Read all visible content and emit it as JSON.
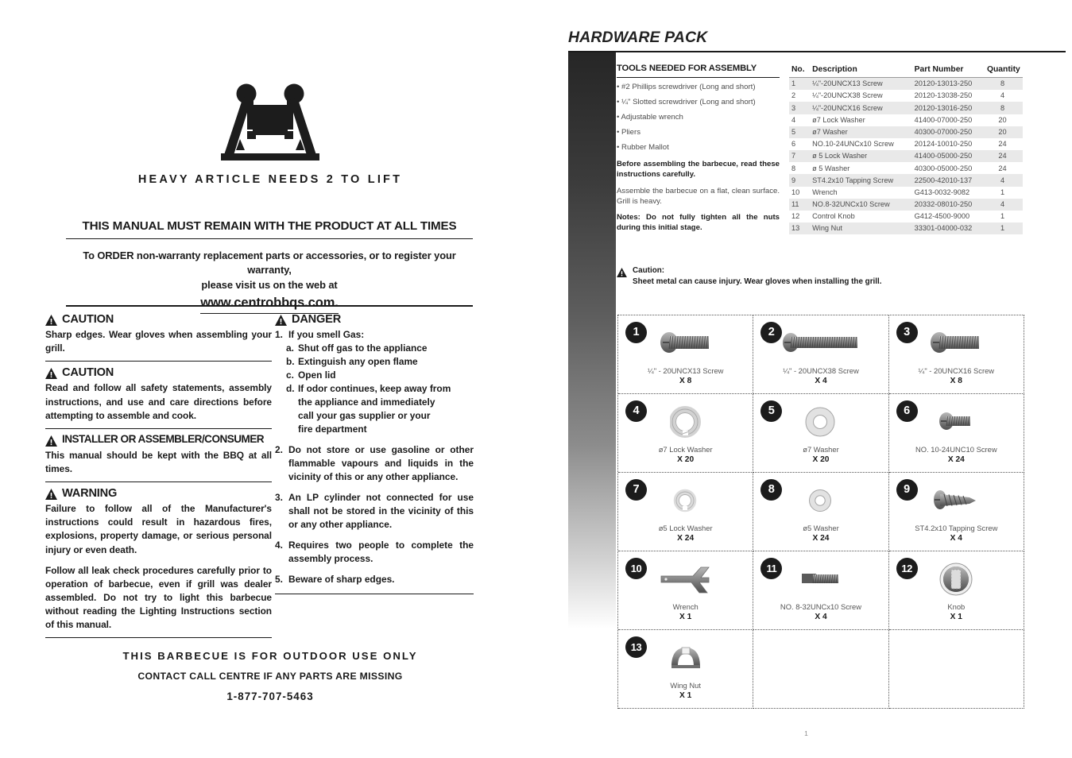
{
  "left": {
    "lift_icon_name": "two-person-lift-icon",
    "lift_caption": "HEAVY ARTICLE NEEDS 2 TO LIFT",
    "manual_banner": "THIS MANUAL MUST REMAIN WITH THE PRODUCT AT ALL TIMES",
    "order_line1": "To ORDER non-warranty replacement parts or accessories, or to register your warranty,",
    "order_line2": "please visit us on the web at",
    "order_url": "www.centrobbqs.com.",
    "sections": [
      {
        "title": "CAUTION",
        "body": "Sharp edges. Wear gloves when assembling your grill."
      },
      {
        "title": "CAUTION",
        "body": "Read and follow all safety statements, assembly instructions, and use and care directions before attempting to assemble and cook."
      },
      {
        "title": "INSTALLER OR ASSEMBLER/CONSUMER",
        "body": "This manual should be kept with the BBQ at all times."
      },
      {
        "title": "WARNING",
        "body": "Failure to follow all of the Manufacturer's instructions could result in hazardous fires, explosions, property damage, or serious personal injury or even death.",
        "body2": "Follow all leak check procedures carefully prior to operation of barbecue, even if grill was dealer assembled. Do not try to light this barbecue without reading the Lighting Instructions section of this manual."
      }
    ],
    "danger": {
      "title": "DANGER",
      "item1_num": "1.",
      "item1_text": "If you smell Gas:",
      "item1_subs": [
        {
          "num": "a.",
          "text": "Shut off gas to the appliance"
        },
        {
          "num": "b.",
          "text": "Extinguish any open flame"
        },
        {
          "num": "c.",
          "text": "Open lid"
        },
        {
          "num": "d.",
          "text": "If odor continues, keep away from"
        }
      ],
      "item1_cont1": "the appliance and immediately",
      "item1_cont2": "call your gas supplier or your",
      "item1_cont3": "fire department",
      "items": [
        {
          "num": "2.",
          "text": "Do not store or use gasoline or other flammable vapours and liquids in the vicinity of this or any other appliance."
        },
        {
          "num": "3.",
          "text": "An LP cylinder not connected for use shall not be stored in the vicinity of this or any other appliance."
        },
        {
          "num": "4.",
          "text": "Requires two people to complete the assembly process."
        },
        {
          "num": "5.",
          "text": "Beware of sharp edges."
        }
      ]
    },
    "bottom_line1": "THIS BARBECUE IS FOR OUTDOOR USE ONLY",
    "bottom_line2": "CONTACT CALL CENTRE IF ANY PARTS ARE MISSING",
    "bottom_phone": "1-877-707-5463"
  },
  "right": {
    "title": "HARDWARE PACK",
    "page_number": "1",
    "tools": {
      "heading": "TOOLS NEEDED FOR ASSEMBLY",
      "items": [
        "• #2 Phillips screwdriver (Long and short)",
        "• ¼\" Slotted screwdriver (Long and short)",
        "• Adjustable wrench",
        "• Pliers",
        "• Rubber Mallot"
      ],
      "before_text": "Before assembling the barbecue, read these instructions carefully.",
      "assemble_text": "Assemble the barbecue on a flat, clean surface. Grill is heavy.",
      "notes_text": "Notes: Do not fully tighten all the nuts during this initial stage."
    },
    "table": {
      "headers": [
        "No.",
        "Description",
        "Part Number",
        "Quantity"
      ],
      "rows": [
        [
          "1",
          "¼\"-20UNCX13 Screw",
          "20120-13013-250",
          "8"
        ],
        [
          "2",
          "¼\"-20UNCX38 Screw",
          "20120-13038-250",
          "4"
        ],
        [
          "3",
          "¼\"-20UNCX16 Screw",
          "20120-13016-250",
          "8"
        ],
        [
          "4",
          "ø7 Lock Washer",
          "41400-07000-250",
          "20"
        ],
        [
          "5",
          "ø7 Washer",
          "40300-07000-250",
          "20"
        ],
        [
          "6",
          "NO.10-24UNCx10 Screw",
          "20124-10010-250",
          "24"
        ],
        [
          "7",
          "ø 5 Lock Washer",
          "41400-05000-250",
          "24"
        ],
        [
          "8",
          "ø 5 Washer",
          "40300-05000-250",
          "24"
        ],
        [
          "9",
          "ST4.2x10 Tapping Screw",
          "22500-42010-137",
          "4"
        ],
        [
          "10",
          "Wrench",
          "G413-0032-9082",
          "1"
        ],
        [
          "11",
          "NO.8-32UNCx10 Screw",
          "20332-08010-250",
          "4"
        ],
        [
          "12",
          "Control Knob",
          "G412-4500-9000",
          "1"
        ],
        [
          "13",
          "Wing Nut",
          "33301-04000-032",
          "1"
        ]
      ]
    },
    "caution": {
      "label": "Caution:",
      "text": "Sheet metal can cause injury. Wear gloves when installing the grill."
    },
    "hardware": [
      {
        "num": "1",
        "art": "pan-head-screw-medium",
        "label": "¼\" - 20UNCX13 Screw",
        "qty": "X 8"
      },
      {
        "num": "2",
        "art": "pan-head-screw-long",
        "label": "¼\" - 20UNCX38 Screw",
        "qty": "X 4"
      },
      {
        "num": "3",
        "art": "pan-head-screw-medium",
        "label": "¼\" - 20UNCX16 Screw",
        "qty": "X 8"
      },
      {
        "num": "4",
        "art": "lock-washer",
        "label": "ø7 Lock Washer",
        "qty": "X 20"
      },
      {
        "num": "5",
        "art": "flat-washer",
        "label": "ø7 Washer",
        "qty": "X 20"
      },
      {
        "num": "6",
        "art": "pan-head-screw-short",
        "label": "NO. 10-24UNC10 Screw",
        "qty": "X 24"
      },
      {
        "num": "7",
        "art": "lock-washer-small",
        "label": "ø5 Lock Washer",
        "qty": "X 24"
      },
      {
        "num": "8",
        "art": "flat-washer-small",
        "label": "ø5 Washer",
        "qty": "X 24"
      },
      {
        "num": "9",
        "art": "tapping-screw",
        "label": "ST4.2x10 Tapping Screw",
        "qty": "X 4"
      },
      {
        "num": "10",
        "art": "wrench",
        "label": "Wrench",
        "qty": "X 1"
      },
      {
        "num": "11",
        "art": "flat-head-screw",
        "label": "NO. 8-32UNCx10 Screw",
        "qty": "X 4"
      },
      {
        "num": "12",
        "art": "control-knob",
        "label": "Knob",
        "qty": "X 1"
      },
      {
        "num": "13",
        "art": "wing-nut",
        "label": "Wing Nut",
        "qty": "X 1"
      }
    ]
  },
  "colors": {
    "ink": "#1a1a1a",
    "muted": "#4b4b4b",
    "row_shade": "#e9e9e9",
    "badge": "#1c1c1c"
  }
}
